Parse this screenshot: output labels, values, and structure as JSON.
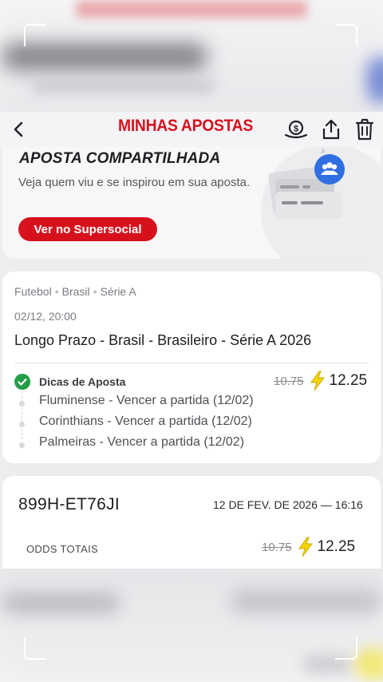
{
  "header": {
    "title": "MINHAS APOSTAS",
    "back_icon": "chevron-left-icon",
    "actions": [
      "money-cashout-icon",
      "share-icon",
      "trash-icon"
    ]
  },
  "promo": {
    "title": "APOSTA COMPARTILHADA",
    "text": "Veja quem viu e se inspirou em sua aposta.",
    "button_label": "Ver no Supersocial",
    "illustration_icon": "people-share-icon"
  },
  "bet": {
    "breadcrumb": [
      "Futebol",
      "Brasil",
      "Série A"
    ],
    "datetime": "02/12, 20:00",
    "event": "Longo Prazo - Brasil - Brasileiro - Série A 2026",
    "selection_title": "Dicas de Aposta",
    "old_odds": "10.75",
    "new_odds": "12.25",
    "legs": [
      "Fluminense - Vencer a partida (12/02)",
      "Corinthians - Vencer a partida (12/02)",
      "Palmeiras - Vencer a partida (12/02)"
    ]
  },
  "summary": {
    "bet_id": "899H-ET76JI",
    "date": "12 DE FEV. DE 2026 — 16:16",
    "odds_label": "ODDS TOTAIS",
    "old_odds": "10.75",
    "new_odds": "12.25"
  },
  "colors": {
    "brand_red": "#d6111e",
    "bolt_yellow": "#f5d300",
    "check_green": "#1f9d45",
    "badge_blue": "#2f6fe0"
  }
}
